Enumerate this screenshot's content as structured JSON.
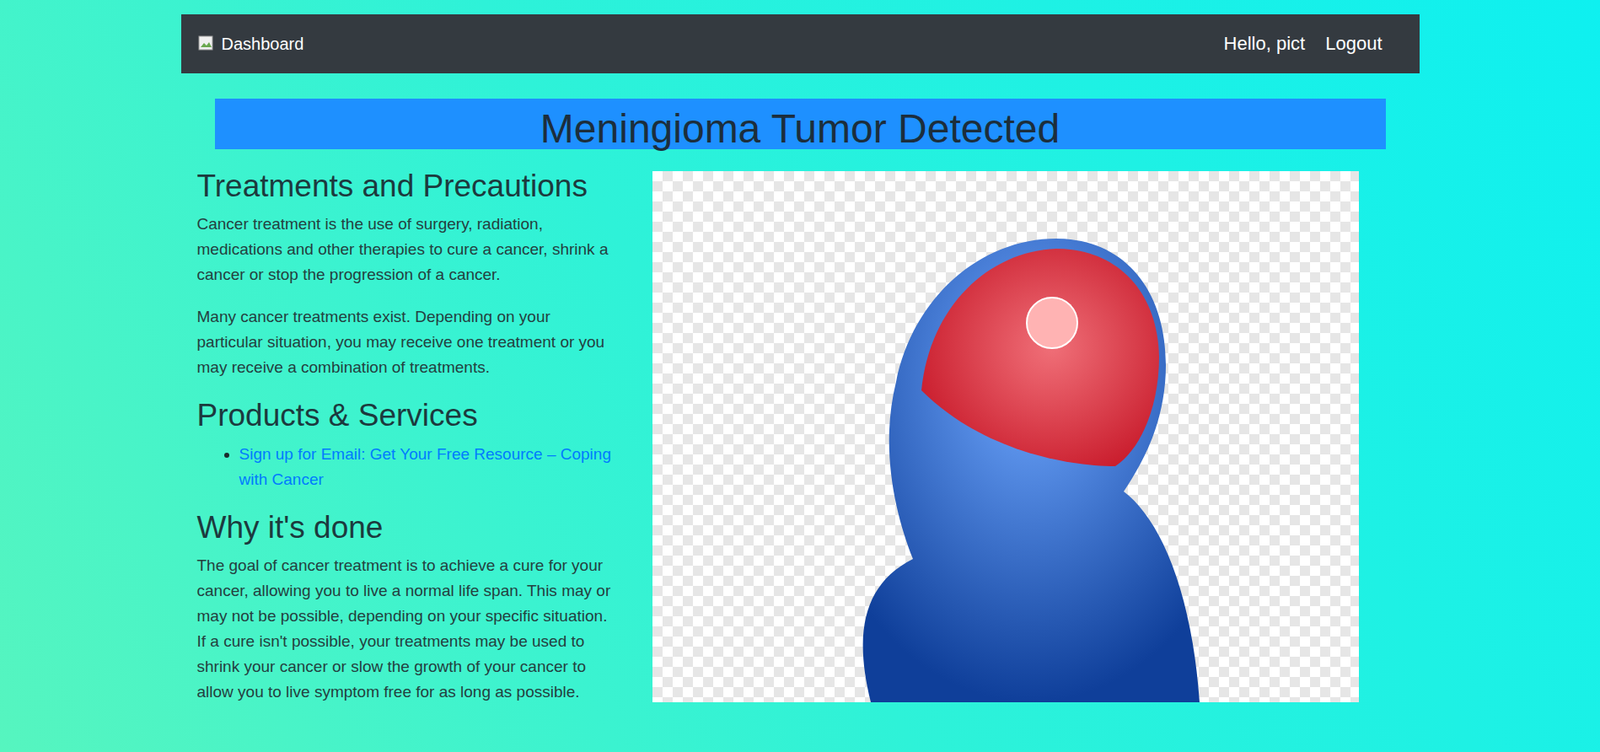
{
  "navbar": {
    "brand": "Dashboard",
    "greeting": "Hello, pict",
    "logout": "Logout"
  },
  "banner": {
    "title": "Meningioma Tumor Detected"
  },
  "sections": [
    {
      "heading": "Treatments and Precautions",
      "paragraphs": [
        "Cancer treatment is the use of surgery, radiation, medications and other therapies to cure a cancer, shrink a cancer or stop the progression of a cancer.",
        "Many cancer treatments exist. Depending on your particular situation, you may receive one treatment or you may receive a combination of treatments."
      ],
      "links": []
    },
    {
      "heading": "Products & Services",
      "paragraphs": [],
      "links": [
        "Sign up for Email: Get Your Free Resource – Coping with Cancer"
      ]
    },
    {
      "heading": "Why it's done",
      "paragraphs": [
        "The goal of cancer treatment is to achieve a cure for your cancer, allowing you to live a normal life span. This may or may not be possible, depending on your specific situation. If a cure isn't possible, your treatments may be used to shrink your cancer or slow the growth of your cancer to allow you to live symptom free for as long as possible."
      ],
      "links": []
    }
  ]
}
